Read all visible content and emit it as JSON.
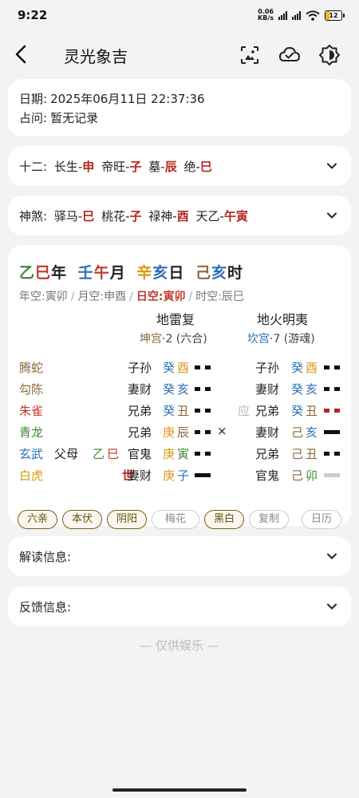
{
  "status": {
    "time": "9:22",
    "net_speed": "0.06",
    "net_unit": "KB/s",
    "battery": "12"
  },
  "header": {
    "title": "灵光象吉"
  },
  "info": {
    "date_label": "日期:",
    "date_value": "2025年06月11日 22:37:36",
    "question_label": "占问:",
    "question_value": "暂无记录"
  },
  "twelve": {
    "label": "十二:",
    "items": [
      {
        "name": "长生-",
        "branch": "申"
      },
      {
        "name": "帝旺-",
        "branch": "子"
      },
      {
        "name": "墓-",
        "branch": "辰"
      },
      {
        "name": "绝-",
        "branch": "巳"
      }
    ]
  },
  "shensha": {
    "label": "神煞:",
    "items": [
      {
        "name": "驿马-",
        "branch": "巳"
      },
      {
        "name": "桃花-",
        "branch": "子"
      },
      {
        "name": "禄神-",
        "branch": "酉"
      },
      {
        "name": "天乙-",
        "branch": "午寅"
      }
    ]
  },
  "pillars": {
    "year": {
      "stem": "乙",
      "branch": "巳",
      "suffix": "年"
    },
    "month": {
      "stem": "壬",
      "branch": "午",
      "suffix": "月"
    },
    "day": {
      "stem": "辛",
      "branch": "亥",
      "suffix": "日"
    },
    "hour": {
      "stem": "己",
      "branch": "亥",
      "suffix": "时"
    }
  },
  "kong": {
    "year": "年空:寅卯",
    "month": "月空:申酉",
    "day": "日空:寅卯",
    "hour": "时空:辰巳",
    "sep": "/"
  },
  "gua": {
    "main": {
      "name": "地雷复",
      "palace": "坤宫",
      "number": "·2 (六合)"
    },
    "changed": {
      "name": "地火明夷",
      "palace": "坎宫",
      "number": "·7 (游魂)"
    }
  },
  "lines": [
    {
      "spirit": "腾蛇",
      "fushen_rel": "",
      "fushen_stem": "",
      "fushen_branch": "",
      "mark": "",
      "rel": "子孙",
      "stem": "癸",
      "branch": "酉",
      "yao": "yin",
      "moving": "",
      "c_mark": "",
      "c_rel": "子孙",
      "c_stem": "癸",
      "c_branch": "酉",
      "c_yao": "yin"
    },
    {
      "spirit": "勾陈",
      "fushen_rel": "",
      "fushen_stem": "",
      "fushen_branch": "",
      "mark": "",
      "rel": "妻财",
      "stem": "癸",
      "branch": "亥",
      "yao": "yin",
      "moving": "",
      "c_mark": "",
      "c_rel": "妻财",
      "c_stem": "癸",
      "c_branch": "亥",
      "c_yao": "yin"
    },
    {
      "spirit": "朱雀",
      "fushen_rel": "",
      "fushen_stem": "",
      "fushen_branch": "",
      "mark": "",
      "rel": "兄弟",
      "stem": "癸",
      "branch": "丑",
      "yao": "yin",
      "moving": "",
      "c_mark": "应",
      "c_rel": "兄弟",
      "c_stem": "癸",
      "c_branch": "丑",
      "c_yao": "yin"
    },
    {
      "spirit": "青龙",
      "fushen_rel": "",
      "fushen_stem": "",
      "fushen_branch": "",
      "mark": "",
      "rel": "兄弟",
      "stem": "庚",
      "branch": "辰",
      "yao": "yin",
      "moving": "×",
      "c_mark": "",
      "c_rel": "妻财",
      "c_stem": "己",
      "c_branch": "亥",
      "c_yao": "yang"
    },
    {
      "spirit": "玄武",
      "fushen_rel": "父母",
      "fushen_stem": "乙",
      "fushen_branch": "巳",
      "mark": "",
      "rel": "官鬼",
      "stem": "庚",
      "branch": "寅",
      "yao": "yin",
      "moving": "",
      "c_mark": "",
      "c_rel": "兄弟",
      "c_stem": "己",
      "c_branch": "丑",
      "c_yao": "yin"
    },
    {
      "spirit": "白虎",
      "fushen_rel": "",
      "fushen_stem": "",
      "fushen_branch": "",
      "mark": "世",
      "rel": "妻财",
      "stem": "庚",
      "branch": "子",
      "yao": "yang",
      "moving": "",
      "c_mark": "",
      "c_rel": "官鬼",
      "c_stem": "己",
      "c_branch": "卯",
      "c_yao": "yang"
    }
  ],
  "chips": [
    "六亲",
    "本伏",
    "阴阳",
    "梅花",
    "黑白",
    "复制",
    "日历"
  ],
  "sections": {
    "reading": "解读信息:",
    "feedback": "反馈信息:"
  },
  "footer": "— 仅供娱乐 —"
}
